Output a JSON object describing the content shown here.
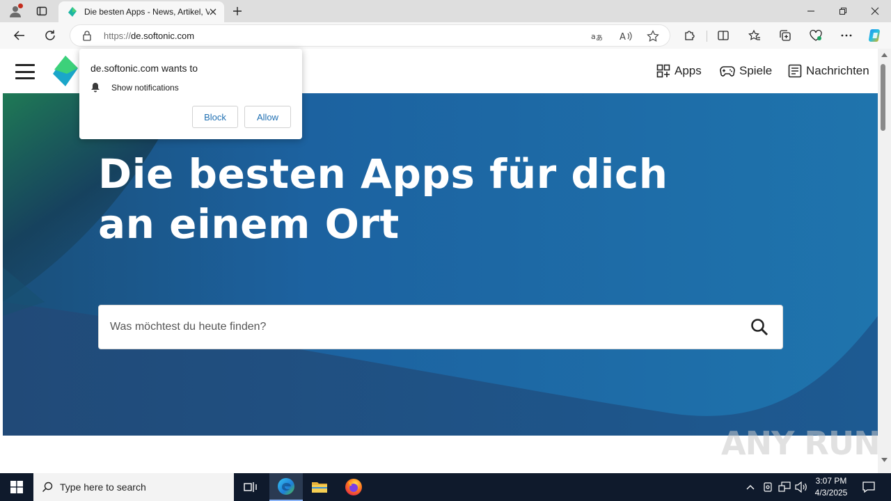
{
  "browser": {
    "tab_title": "Die besten Apps - News, Artikel, Videos",
    "url_scheme": "https://",
    "url_host": "de.softonic.com",
    "colors": {
      "tab_strip": "#dedede",
      "toolbar": "#f7f7f7",
      "accent": "#1f6fb2"
    }
  },
  "site": {
    "nav": {
      "apps": "Apps",
      "games": "Spiele",
      "news": "Nachrichten"
    },
    "hero": {
      "title": "Die besten Apps für dich an einem Ort",
      "search_placeholder": "Was möchtest du heute finden?",
      "colors": {
        "blue": "#1e6fa8",
        "dark_blue": "#1b4f85",
        "green": "#1a6b4a"
      }
    },
    "watermark": "ANY RUN"
  },
  "popup": {
    "title": "de.softonic.com wants to",
    "permission": "Show notifications",
    "block_label": "Block",
    "allow_label": "Allow"
  },
  "taskbar": {
    "search_placeholder": "Type here to search",
    "time": "3:07 PM",
    "date": "4/3/2025"
  }
}
